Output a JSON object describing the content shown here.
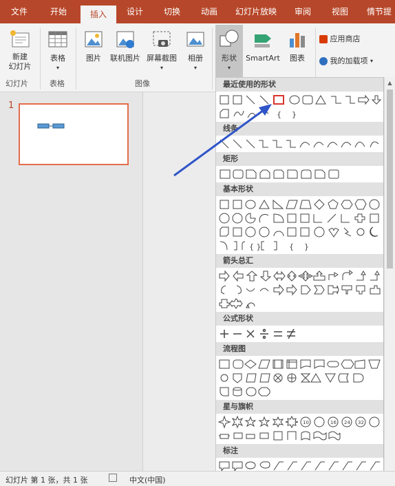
{
  "tabs": [
    "文件",
    "开始",
    "插入",
    "设计",
    "切换",
    "动画",
    "幻灯片放映",
    "审阅",
    "视图",
    "情节提"
  ],
  "ribbon": {
    "new_slide_l1": "新建",
    "new_slide_l2": "幻灯片",
    "table": "表格",
    "picture": "图片",
    "online_picture": "联机图片",
    "screenshot": "屏幕截图",
    "album": "相册",
    "shapes": "形状",
    "smartart": "SmartArt",
    "chart": "图表",
    "store": "应用商店",
    "my_addins": "我的加载项",
    "group_slides": "幻灯片",
    "group_table": "表格",
    "group_images": "图像"
  },
  "thumbnail_number": "1",
  "gallery": {
    "sections": [
      "最近使用的形状",
      "线条",
      "矩形",
      "基本形状",
      "箭头总汇",
      "公式形状",
      "流程图",
      "星与旗帜",
      "标注"
    ]
  },
  "status": {
    "slide_info": "幻灯片 第 1 张，共 1 张",
    "language": "中文(中国)"
  },
  "colors": {
    "brand": "#b7472a",
    "highlight": "#d9342b",
    "arrow": "#2f55c8"
  }
}
